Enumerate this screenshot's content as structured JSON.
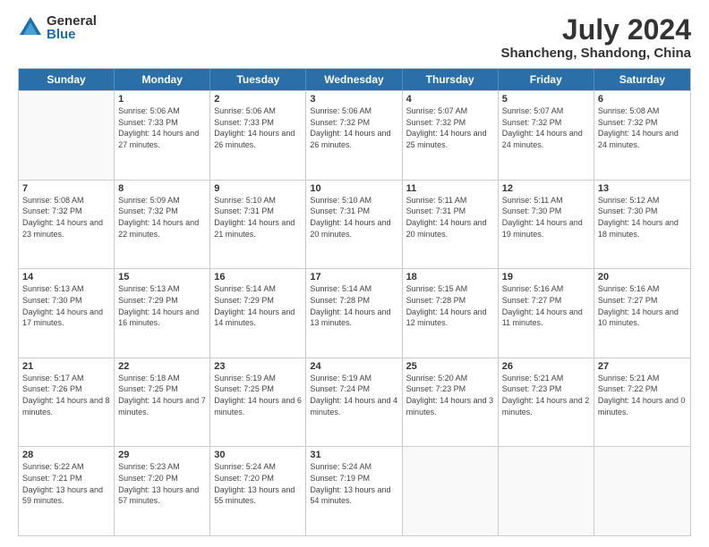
{
  "logo": {
    "general": "General",
    "blue": "Blue"
  },
  "title": "July 2024",
  "subtitle": "Shancheng, Shandong, China",
  "headers": [
    "Sunday",
    "Monday",
    "Tuesday",
    "Wednesday",
    "Thursday",
    "Friday",
    "Saturday"
  ],
  "weeks": [
    [
      {
        "day": "",
        "sunrise": "",
        "sunset": "",
        "daylight": ""
      },
      {
        "day": "1",
        "sunrise": "5:06 AM",
        "sunset": "7:33 PM",
        "daylight": "14 hours and 27 minutes."
      },
      {
        "day": "2",
        "sunrise": "5:06 AM",
        "sunset": "7:33 PM",
        "daylight": "14 hours and 26 minutes."
      },
      {
        "day": "3",
        "sunrise": "5:06 AM",
        "sunset": "7:32 PM",
        "daylight": "14 hours and 26 minutes."
      },
      {
        "day": "4",
        "sunrise": "5:07 AM",
        "sunset": "7:32 PM",
        "daylight": "14 hours and 25 minutes."
      },
      {
        "day": "5",
        "sunrise": "5:07 AM",
        "sunset": "7:32 PM",
        "daylight": "14 hours and 24 minutes."
      },
      {
        "day": "6",
        "sunrise": "5:08 AM",
        "sunset": "7:32 PM",
        "daylight": "14 hours and 24 minutes."
      }
    ],
    [
      {
        "day": "7",
        "sunrise": "5:08 AM",
        "sunset": "7:32 PM",
        "daylight": "14 hours and 23 minutes."
      },
      {
        "day": "8",
        "sunrise": "5:09 AM",
        "sunset": "7:32 PM",
        "daylight": "14 hours and 22 minutes."
      },
      {
        "day": "9",
        "sunrise": "5:10 AM",
        "sunset": "7:31 PM",
        "daylight": "14 hours and 21 minutes."
      },
      {
        "day": "10",
        "sunrise": "5:10 AM",
        "sunset": "7:31 PM",
        "daylight": "14 hours and 20 minutes."
      },
      {
        "day": "11",
        "sunrise": "5:11 AM",
        "sunset": "7:31 PM",
        "daylight": "14 hours and 20 minutes."
      },
      {
        "day": "12",
        "sunrise": "5:11 AM",
        "sunset": "7:30 PM",
        "daylight": "14 hours and 19 minutes."
      },
      {
        "day": "13",
        "sunrise": "5:12 AM",
        "sunset": "7:30 PM",
        "daylight": "14 hours and 18 minutes."
      }
    ],
    [
      {
        "day": "14",
        "sunrise": "5:13 AM",
        "sunset": "7:30 PM",
        "daylight": "14 hours and 17 minutes."
      },
      {
        "day": "15",
        "sunrise": "5:13 AM",
        "sunset": "7:29 PM",
        "daylight": "14 hours and 16 minutes."
      },
      {
        "day": "16",
        "sunrise": "5:14 AM",
        "sunset": "7:29 PM",
        "daylight": "14 hours and 14 minutes."
      },
      {
        "day": "17",
        "sunrise": "5:14 AM",
        "sunset": "7:28 PM",
        "daylight": "14 hours and 13 minutes."
      },
      {
        "day": "18",
        "sunrise": "5:15 AM",
        "sunset": "7:28 PM",
        "daylight": "14 hours and 12 minutes."
      },
      {
        "day": "19",
        "sunrise": "5:16 AM",
        "sunset": "7:27 PM",
        "daylight": "14 hours and 11 minutes."
      },
      {
        "day": "20",
        "sunrise": "5:16 AM",
        "sunset": "7:27 PM",
        "daylight": "14 hours and 10 minutes."
      }
    ],
    [
      {
        "day": "21",
        "sunrise": "5:17 AM",
        "sunset": "7:26 PM",
        "daylight": "14 hours and 8 minutes."
      },
      {
        "day": "22",
        "sunrise": "5:18 AM",
        "sunset": "7:25 PM",
        "daylight": "14 hours and 7 minutes."
      },
      {
        "day": "23",
        "sunrise": "5:19 AM",
        "sunset": "7:25 PM",
        "daylight": "14 hours and 6 minutes."
      },
      {
        "day": "24",
        "sunrise": "5:19 AM",
        "sunset": "7:24 PM",
        "daylight": "14 hours and 4 minutes."
      },
      {
        "day": "25",
        "sunrise": "5:20 AM",
        "sunset": "7:23 PM",
        "daylight": "14 hours and 3 minutes."
      },
      {
        "day": "26",
        "sunrise": "5:21 AM",
        "sunset": "7:23 PM",
        "daylight": "14 hours and 2 minutes."
      },
      {
        "day": "27",
        "sunrise": "5:21 AM",
        "sunset": "7:22 PM",
        "daylight": "14 hours and 0 minutes."
      }
    ],
    [
      {
        "day": "28",
        "sunrise": "5:22 AM",
        "sunset": "7:21 PM",
        "daylight": "13 hours and 59 minutes."
      },
      {
        "day": "29",
        "sunrise": "5:23 AM",
        "sunset": "7:20 PM",
        "daylight": "13 hours and 57 minutes."
      },
      {
        "day": "30",
        "sunrise": "5:24 AM",
        "sunset": "7:20 PM",
        "daylight": "13 hours and 55 minutes."
      },
      {
        "day": "31",
        "sunrise": "5:24 AM",
        "sunset": "7:19 PM",
        "daylight": "13 hours and 54 minutes."
      },
      {
        "day": "",
        "sunrise": "",
        "sunset": "",
        "daylight": ""
      },
      {
        "day": "",
        "sunrise": "",
        "sunset": "",
        "daylight": ""
      },
      {
        "day": "",
        "sunrise": "",
        "sunset": "",
        "daylight": ""
      }
    ]
  ]
}
